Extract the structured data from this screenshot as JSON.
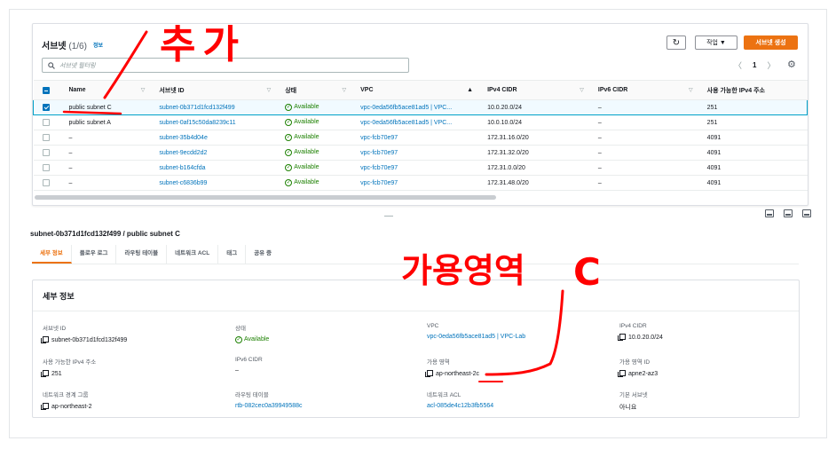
{
  "subnets_panel": {
    "title": "서브넷",
    "count": "(1/6)",
    "info_link": "정보",
    "refresh_icon": "↻",
    "actions_label": "작업 ▼",
    "create_label": "서브넷 생성",
    "search_placeholder": "서브넷 필터링",
    "page_number": "1",
    "prev_glyph": "〈",
    "next_glyph": "〉",
    "settings_glyph": "⚙"
  },
  "table": {
    "headers": [
      "Name",
      "서브넷 ID",
      "상태",
      "VPC",
      "IPv4 CIDR",
      "IPv6 CIDR",
      "사용 가능한 IPv4 주소"
    ],
    "rows": [
      {
        "name": "public subnet C",
        "id": "subnet-0b371d1fcd132f499",
        "status": "Available",
        "vpc": "vpc-0eda56fb5ace81ad5 | VPC...",
        "ipv4": "10.0.20.0/24",
        "ipv6": "–",
        "avail": "251",
        "selected": true
      },
      {
        "name": "public subnet A",
        "id": "subnet-0af15c50da8239c11",
        "status": "Available",
        "vpc": "vpc-0eda56fb5ace81ad5 | VPC...",
        "ipv4": "10.0.10.0/24",
        "ipv6": "–",
        "avail": "251",
        "selected": false
      },
      {
        "name": "–",
        "id": "subnet-35b4d04e",
        "status": "Available",
        "vpc": "vpc-fcb70e97",
        "ipv4": "172.31.16.0/20",
        "ipv6": "–",
        "avail": "4091",
        "selected": false
      },
      {
        "name": "–",
        "id": "subnet-9ecdd2d2",
        "status": "Available",
        "vpc": "vpc-fcb70e97",
        "ipv4": "172.31.32.0/20",
        "ipv6": "–",
        "avail": "4091",
        "selected": false
      },
      {
        "name": "–",
        "id": "subnet-b164cfda",
        "status": "Available",
        "vpc": "vpc-fcb70e97",
        "ipv4": "172.31.0.0/20",
        "ipv6": "–",
        "avail": "4091",
        "selected": false
      },
      {
        "name": "–",
        "id": "subnet-c6836b99",
        "status": "Available",
        "vpc": "vpc-fcb70e97",
        "ipv4": "172.31.48.0/20",
        "ipv6": "–",
        "avail": "4091",
        "selected": false
      }
    ]
  },
  "detail": {
    "title": "subnet-0b371d1fcd132f499 / public subnet C",
    "tabs": [
      "세부 정보",
      "플로우 로그",
      "라우팅 테이블",
      "네트워크 ACL",
      "태그",
      "공유 중"
    ],
    "panel_title": "세부 정보",
    "fields": {
      "subnet_id": {
        "label": "서브넷 ID",
        "value": "subnet-0b371d1fcd132f499"
      },
      "state": {
        "label": "상태",
        "value": "Available"
      },
      "vpc": {
        "label": "VPC",
        "value": "vpc-0eda56fb5ace81ad5 | VPC-Lab"
      },
      "ipv4_cidr": {
        "label": "IPv4 CIDR",
        "value": "10.0.20.0/24"
      },
      "avail_ipv4": {
        "label": "사용 가능한 IPv4 주소",
        "value": "251"
      },
      "ipv6_cidr": {
        "label": "IPv6 CIDR",
        "value": "–"
      },
      "az": {
        "label": "가용 영역",
        "value": "ap-northeast-2c"
      },
      "az_id": {
        "label": "가용 영역 ID",
        "value": "apne2-az3"
      },
      "border_group": {
        "label": "네트워크 경계 그룹",
        "value": "ap-northeast-2"
      },
      "route_table": {
        "label": "라우팅 테이블",
        "value": "rtb-082cec0a39949588c"
      },
      "nacl": {
        "label": "네트워크 ACL",
        "value": "acl-085de4c12b3fb5564"
      },
      "default_subnet": {
        "label": "기본 서브넷",
        "value": "아니요"
      }
    }
  },
  "annotations": {
    "add_note": "추가",
    "az_note": "가용영역",
    "c_note": "C",
    "color": "#ff0000"
  }
}
